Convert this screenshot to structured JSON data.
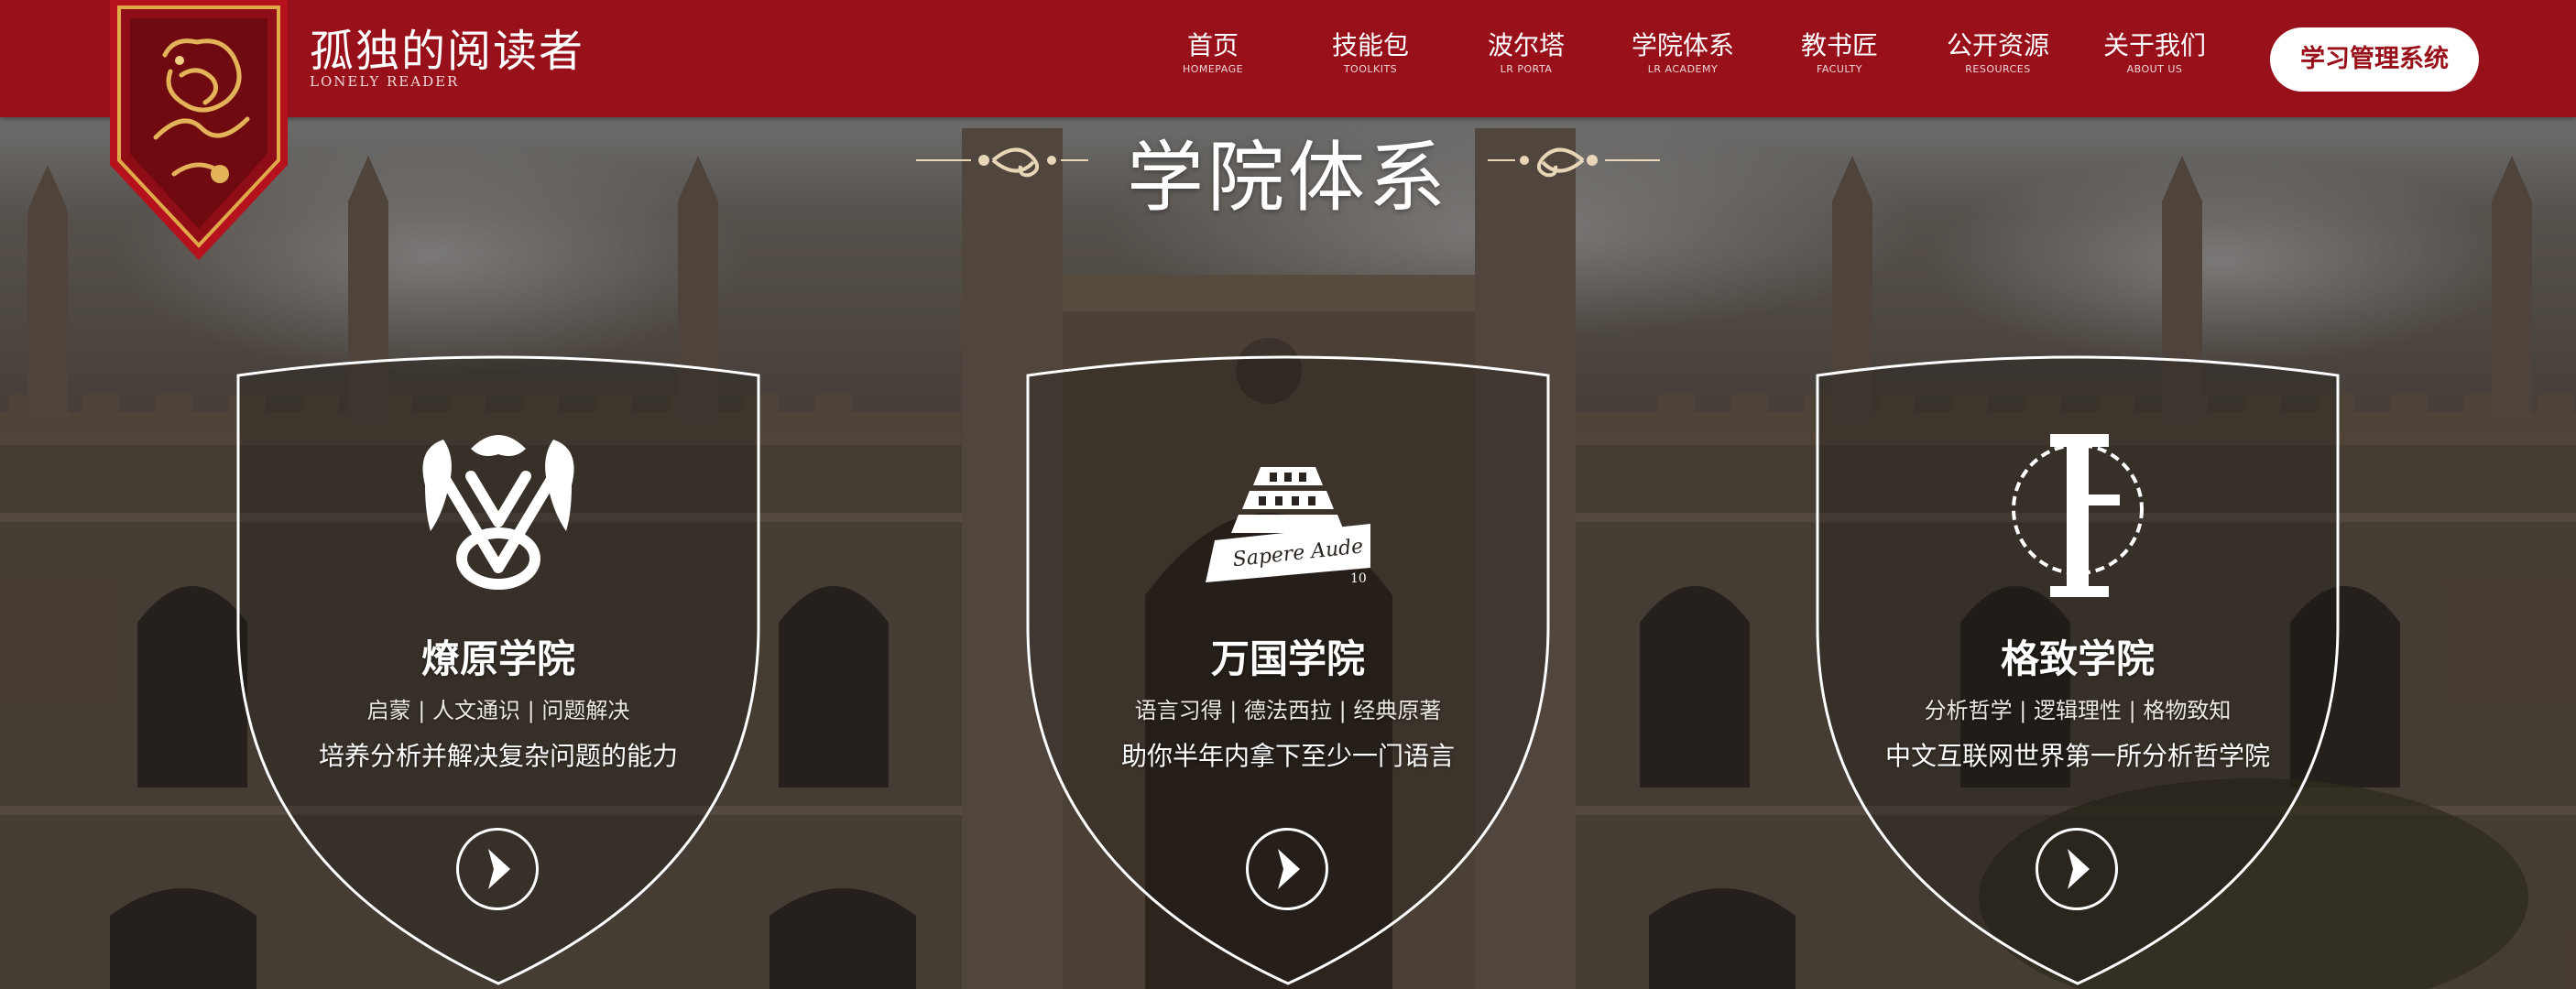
{
  "brand": {
    "name_cn": "孤独的阅读者",
    "name_en": "LONELY READER",
    "colors": {
      "primary": "#98101a",
      "gold": "#c9a25a"
    }
  },
  "nav": {
    "items": [
      {
        "label": "首页",
        "sub": "HOMEPAGE"
      },
      {
        "label": "技能包",
        "sub": "TOOLKITS"
      },
      {
        "label": "波尔塔",
        "sub": "LR PORTA"
      },
      {
        "label": "学院体系",
        "sub": "LR ACADEMY"
      },
      {
        "label": "教书匠",
        "sub": "FACULTY"
      },
      {
        "label": "公开资源",
        "sub": "RESOURCES"
      },
      {
        "label": "关于我们",
        "sub": "ABOUT US"
      }
    ],
    "lms_button": "学习管理系统"
  },
  "section": {
    "title": "学院体系"
  },
  "academies": [
    {
      "name": "燎原学院",
      "tags": "启蒙 | 人文通识 | 问题解决",
      "description": "培养分析并解决复杂问题的能力",
      "icon": "dragon-crest-icon"
    },
    {
      "name": "万国学院",
      "tags": "语言习得 | 德法西拉 | 经典原著",
      "description": "助你半年内拿下至少一门语言",
      "icon": "tower-of-babel-icon",
      "emblem_text": "Sapere Aude",
      "emblem_number": "10"
    },
    {
      "name": "格致学院",
      "tags": "分析哲学 | 逻辑理性 | 格物致知",
      "description": "中文互联网世界第一所分析哲学院",
      "icon": "thorn-letter-f-icon"
    }
  ]
}
